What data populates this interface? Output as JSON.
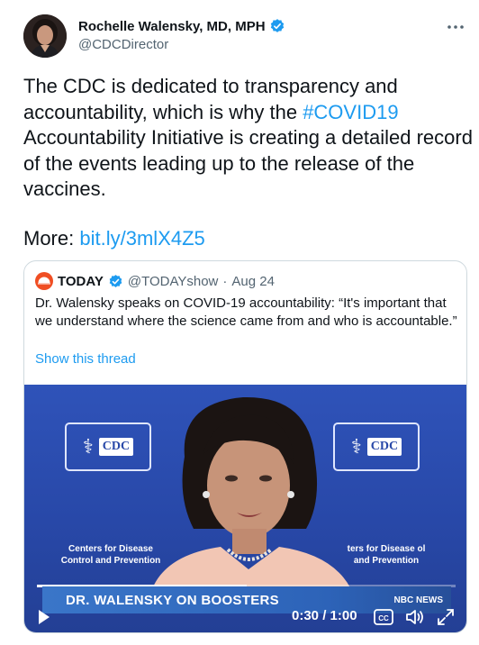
{
  "author": {
    "name": "Rochelle Walensky, MD, MPH",
    "handle": "@CDCDirector",
    "verified": true
  },
  "tweet": {
    "text_before_hashtag": "The CDC is dedicated to transparency and accountability, which is why the ",
    "hashtag": "#COVID19",
    "text_after_hashtag": " Accountability Initiative is creating a detailed record of the events leading up to the release of the vaccines.",
    "more_label": "More: ",
    "link": "bit.ly/3mlX4Z5"
  },
  "quote": {
    "name": "TODAY",
    "handle": "@TODAYshow",
    "separator": "·",
    "date": "Aug 24",
    "text": "Dr. Walensky speaks on COVID-19 accountability: “It's important that we understand where the science came from and who is accountable.”",
    "show_thread": "Show this thread"
  },
  "video": {
    "logo_text": "CDC",
    "backdrop_caption_left": "Centers for Disease Control and Prevention",
    "backdrop_caption_right": "ters for Disease ol and Prevention",
    "banner": "DR. WALENSKY ON BOOSTERS",
    "network": "NBC NEWS",
    "time_display": "0:30 / 1:00",
    "progress_fraction": 0.5,
    "cc_label": "CC"
  },
  "colors": {
    "link": "#1d9bf0",
    "verified": "#1d9bf0",
    "text": "#0f1419",
    "muted": "#536471",
    "border": "#cfd9de",
    "today_brand": "#f04e23"
  },
  "icons": [
    "verified-badge-icon",
    "more-icon",
    "today-logo-icon",
    "play-icon",
    "captions-icon",
    "volume-icon",
    "fullscreen-icon",
    "cdc-logo-icon"
  ]
}
